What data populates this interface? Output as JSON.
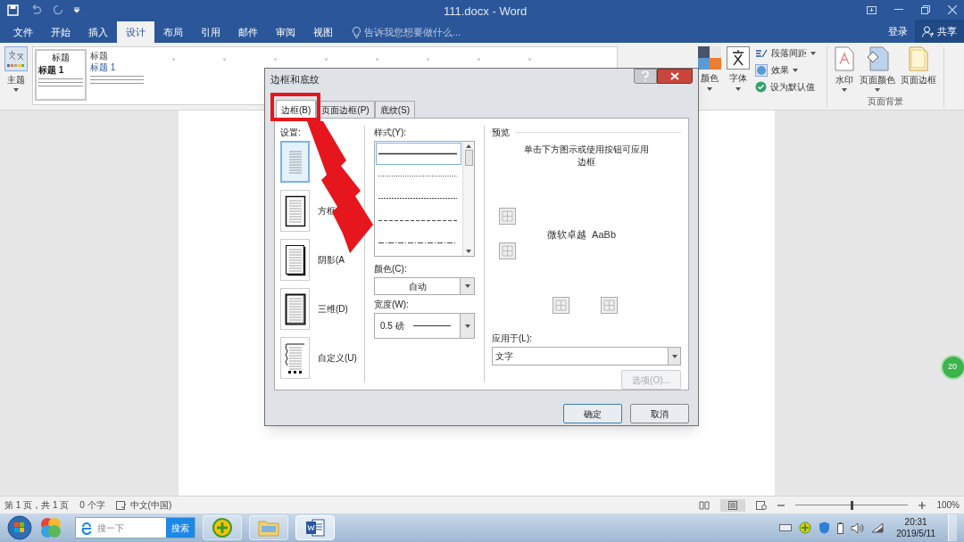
{
  "title_bar": {
    "title": "111.docx - Word"
  },
  "menu_tabs": [
    {
      "label": "文件",
      "selected": false
    },
    {
      "label": "开始",
      "selected": false
    },
    {
      "label": "插入",
      "selected": false
    },
    {
      "label": "设计",
      "selected": true
    },
    {
      "label": "布局",
      "selected": false
    },
    {
      "label": "引用",
      "selected": false
    },
    {
      "label": "邮件",
      "selected": false
    },
    {
      "label": "审阅",
      "selected": false
    },
    {
      "label": "视图",
      "selected": false
    }
  ],
  "tell_me": {
    "placeholder": "告诉我您想要做什么..."
  },
  "account": {
    "sign_in": "登录",
    "share": "共享"
  },
  "ribbon": {
    "theme_button": "主题",
    "style_gallery": [
      {
        "title": "标题",
        "heading": "标题 1"
      },
      {
        "title": "标题",
        "heading": "标题 1"
      }
    ],
    "colors_button": "颜色",
    "fonts_button": "字体",
    "paragraph_spacing": "段落间距",
    "effects": "效果",
    "set_default": "设为默认值",
    "page_background": [
      {
        "label": "水印",
        "kind": "watermark"
      },
      {
        "label": "页面颜色",
        "kind": "color"
      },
      {
        "label": "页面边框",
        "kind": "border"
      }
    ],
    "group_label": "页面背景"
  },
  "dialog": {
    "title": "边框和底纹",
    "tabs": [
      {
        "label": "边框(B)",
        "selected": true
      },
      {
        "label": "页面边框(P)",
        "selected": false
      },
      {
        "label": "底纹(S)",
        "selected": false
      }
    ],
    "settings_label": "设置:",
    "settings": [
      {
        "kind": "none",
        "selected": true
      },
      {
        "kind": "box",
        "label": "方框",
        "selected": false
      },
      {
        "kind": "shadow",
        "label": "阴影(A",
        "selected": false
      },
      {
        "kind": "threed",
        "label": "三维(D)",
        "selected": false
      },
      {
        "kind": "custom",
        "label": "自定义(U)",
        "selected": false
      }
    ],
    "style_label": "样式(Y):",
    "line_styles": [
      {
        "kind": "solid",
        "selected": true
      },
      {
        "kind": "dotted",
        "selected": false
      },
      {
        "kind": "finedash",
        "selected": false
      },
      {
        "kind": "dash",
        "selected": false
      },
      {
        "kind": "dashdot",
        "selected": false
      }
    ],
    "color_label": "颜色(C):",
    "color_value": "自动",
    "width_label": "宽度(W):",
    "width_value": "0.5 磅",
    "preview_label": "预览",
    "preview_hint": "单击下方图示或使用按钮可应用边框",
    "preview_sample": "微软卓越  AaBb",
    "apply_label": "应用于(L):",
    "apply_value": "文字",
    "options_button": {
      "label": "选项(O)...",
      "disabled": true
    },
    "ok_button": "确定",
    "cancel_button": "取消"
  },
  "status_bar": {
    "page": "第 1 页，共 1 页",
    "words": "0 个字",
    "language": "中文(中国)",
    "zoom": "100%",
    "zoom_slider": {
      "level": 0.5
    }
  },
  "taskbar": {
    "search_placeholder": "搜一下",
    "search_button": "搜索",
    "time": "20:31",
    "date": "2019/5/11"
  },
  "floating_ball": {
    "text": "20"
  }
}
